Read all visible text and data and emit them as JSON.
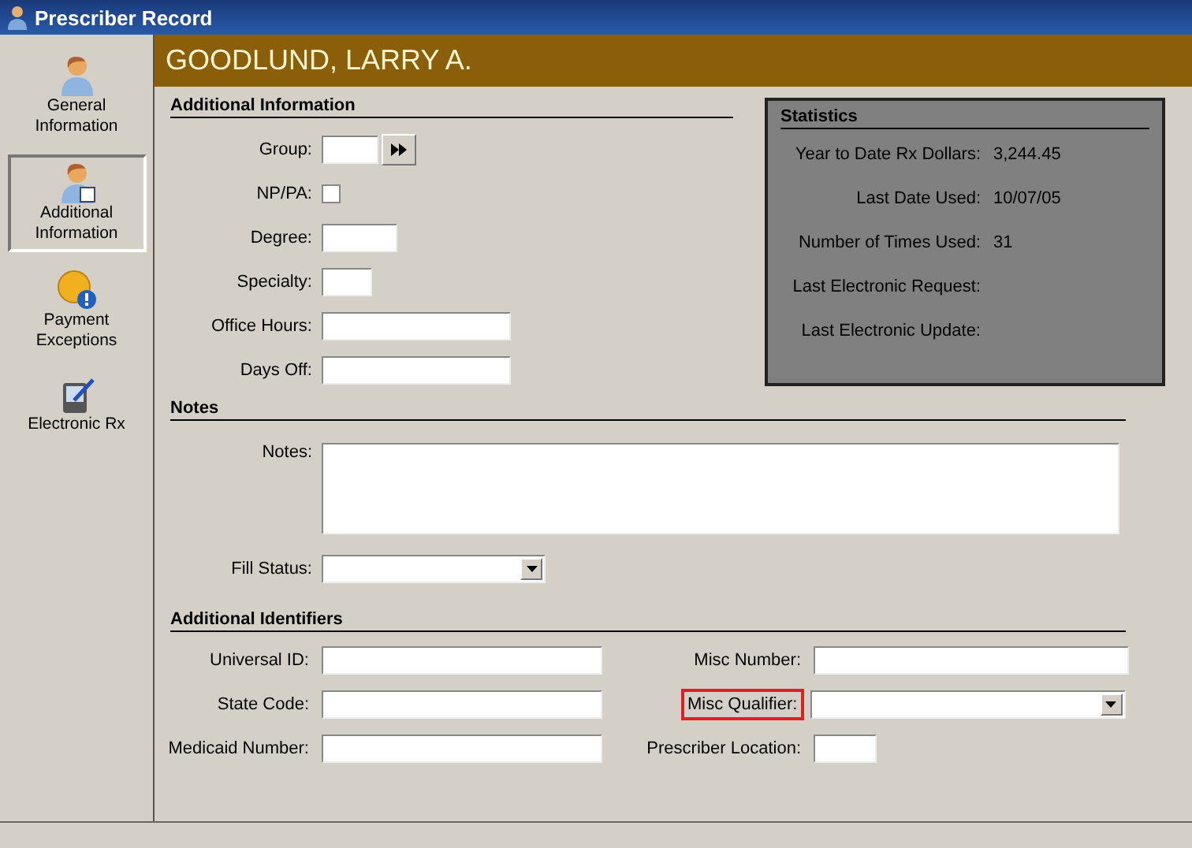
{
  "window": {
    "title": "Prescriber Record"
  },
  "sidebar": {
    "items": [
      {
        "label": "General Information",
        "selected": false
      },
      {
        "label": "Additional Information",
        "selected": true
      },
      {
        "label": "Payment Exceptions",
        "selected": false
      },
      {
        "label": "Electronic Rx",
        "selected": false
      }
    ]
  },
  "header": {
    "name": "GOODLUND, LARRY A."
  },
  "additional_information": {
    "title": "Additional Information",
    "fields": [
      {
        "label": "Group:",
        "kind": "lookup"
      },
      {
        "label": "NP/PA:",
        "kind": "checkbox",
        "checked": false
      },
      {
        "label": "Degree:",
        "kind": "text"
      },
      {
        "label": "Specialty:",
        "kind": "text"
      },
      {
        "label": "Office Hours:",
        "kind": "text"
      },
      {
        "label": "Days Off:",
        "kind": "text"
      }
    ]
  },
  "statistics": {
    "title": "Statistics",
    "rows": [
      {
        "label": "Year to Date Rx Dollars:",
        "value": "3,244.45"
      },
      {
        "label": "Last Date Used:",
        "value": "10/07/05"
      },
      {
        "label": "Number of Times Used:",
        "value": "31"
      },
      {
        "label": "Last Electronic Request:"
      },
      {
        "label": "Last Electronic Update:"
      }
    ]
  },
  "notes": {
    "title": "Notes",
    "fields": [
      {
        "label": "Notes:",
        "kind": "textarea"
      },
      {
        "label": "Fill Status:",
        "kind": "dropdown"
      }
    ]
  },
  "additional_identifiers": {
    "title": "Additional Identifiers",
    "fields": [
      {
        "label": "Universal ID:",
        "kind": "text",
        "highlighted": false
      },
      {
        "label": "Misc Number:",
        "kind": "text",
        "highlighted": false
      },
      {
        "label": "State Code:",
        "kind": "text",
        "highlighted": false
      },
      {
        "label": "Misc Qualifier:",
        "kind": "dropdown",
        "highlighted": true
      },
      {
        "label": "Medicaid Number:",
        "kind": "text",
        "highlighted": false
      },
      {
        "label": "Prescriber Location:",
        "kind": "text",
        "highlighted": false
      }
    ]
  }
}
